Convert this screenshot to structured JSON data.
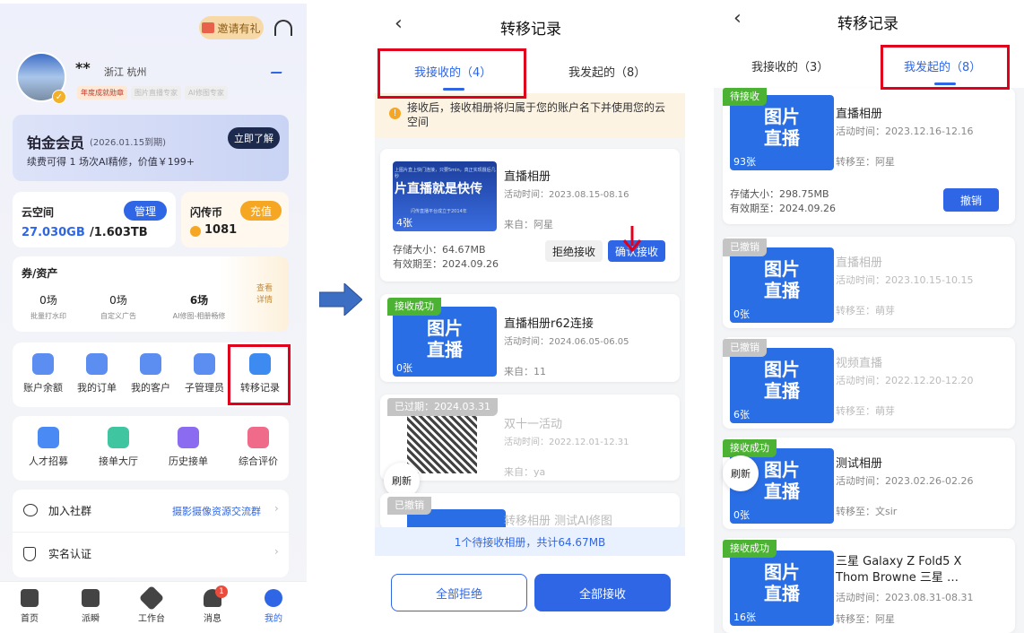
{
  "profile": {
    "invite_label": "邀请有礼",
    "name": "**",
    "location": "浙江 杭州",
    "badges": [
      "年度成就勋章",
      "图片直播专家",
      "AI修图专家"
    ]
  },
  "vip": {
    "title": "铂金会员",
    "expiry": "(2026.01.15到期)",
    "desc": "续费可得 1 场次AI精修，价值￥199+",
    "btn": "立即了解"
  },
  "cloud": {
    "title": "云空间",
    "btn": "管理",
    "used": "27.030GB",
    "total": "/1.603TB"
  },
  "coins": {
    "title": "闪传币",
    "btn": "充值",
    "value": "1081"
  },
  "assets": {
    "title": "券/资产",
    "items": [
      {
        "value": "0场",
        "label": "批量打水印"
      },
      {
        "value": "0场",
        "label": "自定义广告"
      },
      {
        "value": "6场",
        "label": "AI修图-相册畅修"
      }
    ],
    "more": "查看\n详情"
  },
  "grid1": [
    "账户余额",
    "我的订单",
    "我的客户",
    "子管理员",
    "转移记录"
  ],
  "grid2": [
    "人才招募",
    "接单大厅",
    "历史接单",
    "综合评价"
  ],
  "list": [
    {
      "label": "加入社群",
      "value": "摄影摄像资源交流群"
    },
    {
      "label": "实名认证",
      "value": ""
    }
  ],
  "tabbar": [
    "首页",
    "派瞬",
    "工作台",
    "消息",
    "我的"
  ],
  "msg_badge": "1",
  "p2": {
    "title": "转移记录",
    "tab_received": "我接收的（4）",
    "tab_sent": "我发起的（8）",
    "notice": "接收后，接收相册将归属于您的账户名下并使用您的云空间",
    "records": [
      {
        "title": "直播相册",
        "time": "活动时间：2023.08.15-08.16",
        "from": "来自：阿星",
        "thumb_line1": "上图片直上快门连接，只要5min，真正实现摄后几秒",
        "thumb_line2": "片直播就是快传",
        "thumb_line3": "闪传直播平台成立于2014年",
        "thumb_count": "4张",
        "size": "存储大小：64.67MB",
        "expire": "有效期至：2024.09.26",
        "reject": "拒绝接收",
        "accept": "确认接收"
      },
      {
        "tag": "接收成功",
        "title": "直播相册r62连接",
        "time": "活动时间：2024.06.05-06.05",
        "from": "来自：11",
        "thumb_text": "图片\n直播",
        "thumb_count": "0张"
      },
      {
        "tag": "已过期：2024.03.31",
        "title": "双十一活动",
        "time": "活动时间：2022.12.01-12.31",
        "from": "来自：ya"
      },
      {
        "tag": "已撤销",
        "title": "转移相册 测试AI修图"
      }
    ],
    "refresh": "刷新",
    "summary": "1个待接收相册，共计64.67MB",
    "reject_all": "全部拒绝",
    "accept_all": "全部接收"
  },
  "p3": {
    "title": "转移记录",
    "tab_received": "我接收的（3）",
    "tab_sent": "我发起的（8）",
    "records": [
      {
        "tag": "待接收",
        "title": "直播相册",
        "time": "活动时间：2023.12.16-12.16",
        "to": "转移至：阿星",
        "count": "93张",
        "size": "存储大小：298.75MB",
        "expire": "有效期至：2024.09.26",
        "btn": "撤销"
      },
      {
        "tag": "已撤销",
        "title": "直播相册",
        "time": "活动时间：2023.10.15-10.15",
        "to": "转移至：萌芽",
        "count": "0张"
      },
      {
        "tag": "已撤销",
        "title": "视频直播",
        "time": "活动时间：2022.12.20-12.20",
        "to": "转移至：萌芽",
        "count": "6张"
      },
      {
        "tag": "接收成功",
        "title": "测试相册",
        "time": "活动时间：2023.02.26-02.26",
        "to": "转移至：文sir",
        "count": "0张"
      },
      {
        "tag": "接收成功",
        "title": "三星 Galaxy Z Fold5 X Thom Browne 三星 …",
        "time": "活动时间：2023.08.31-08.31",
        "to": "转移至：阿星",
        "count": "16张"
      }
    ],
    "thumb_text": "图片\n直播",
    "refresh": "刷新"
  },
  "colors": {
    "accent": "#2f66e6",
    "success": "#4cb233",
    "highlight": "#e0001b"
  }
}
